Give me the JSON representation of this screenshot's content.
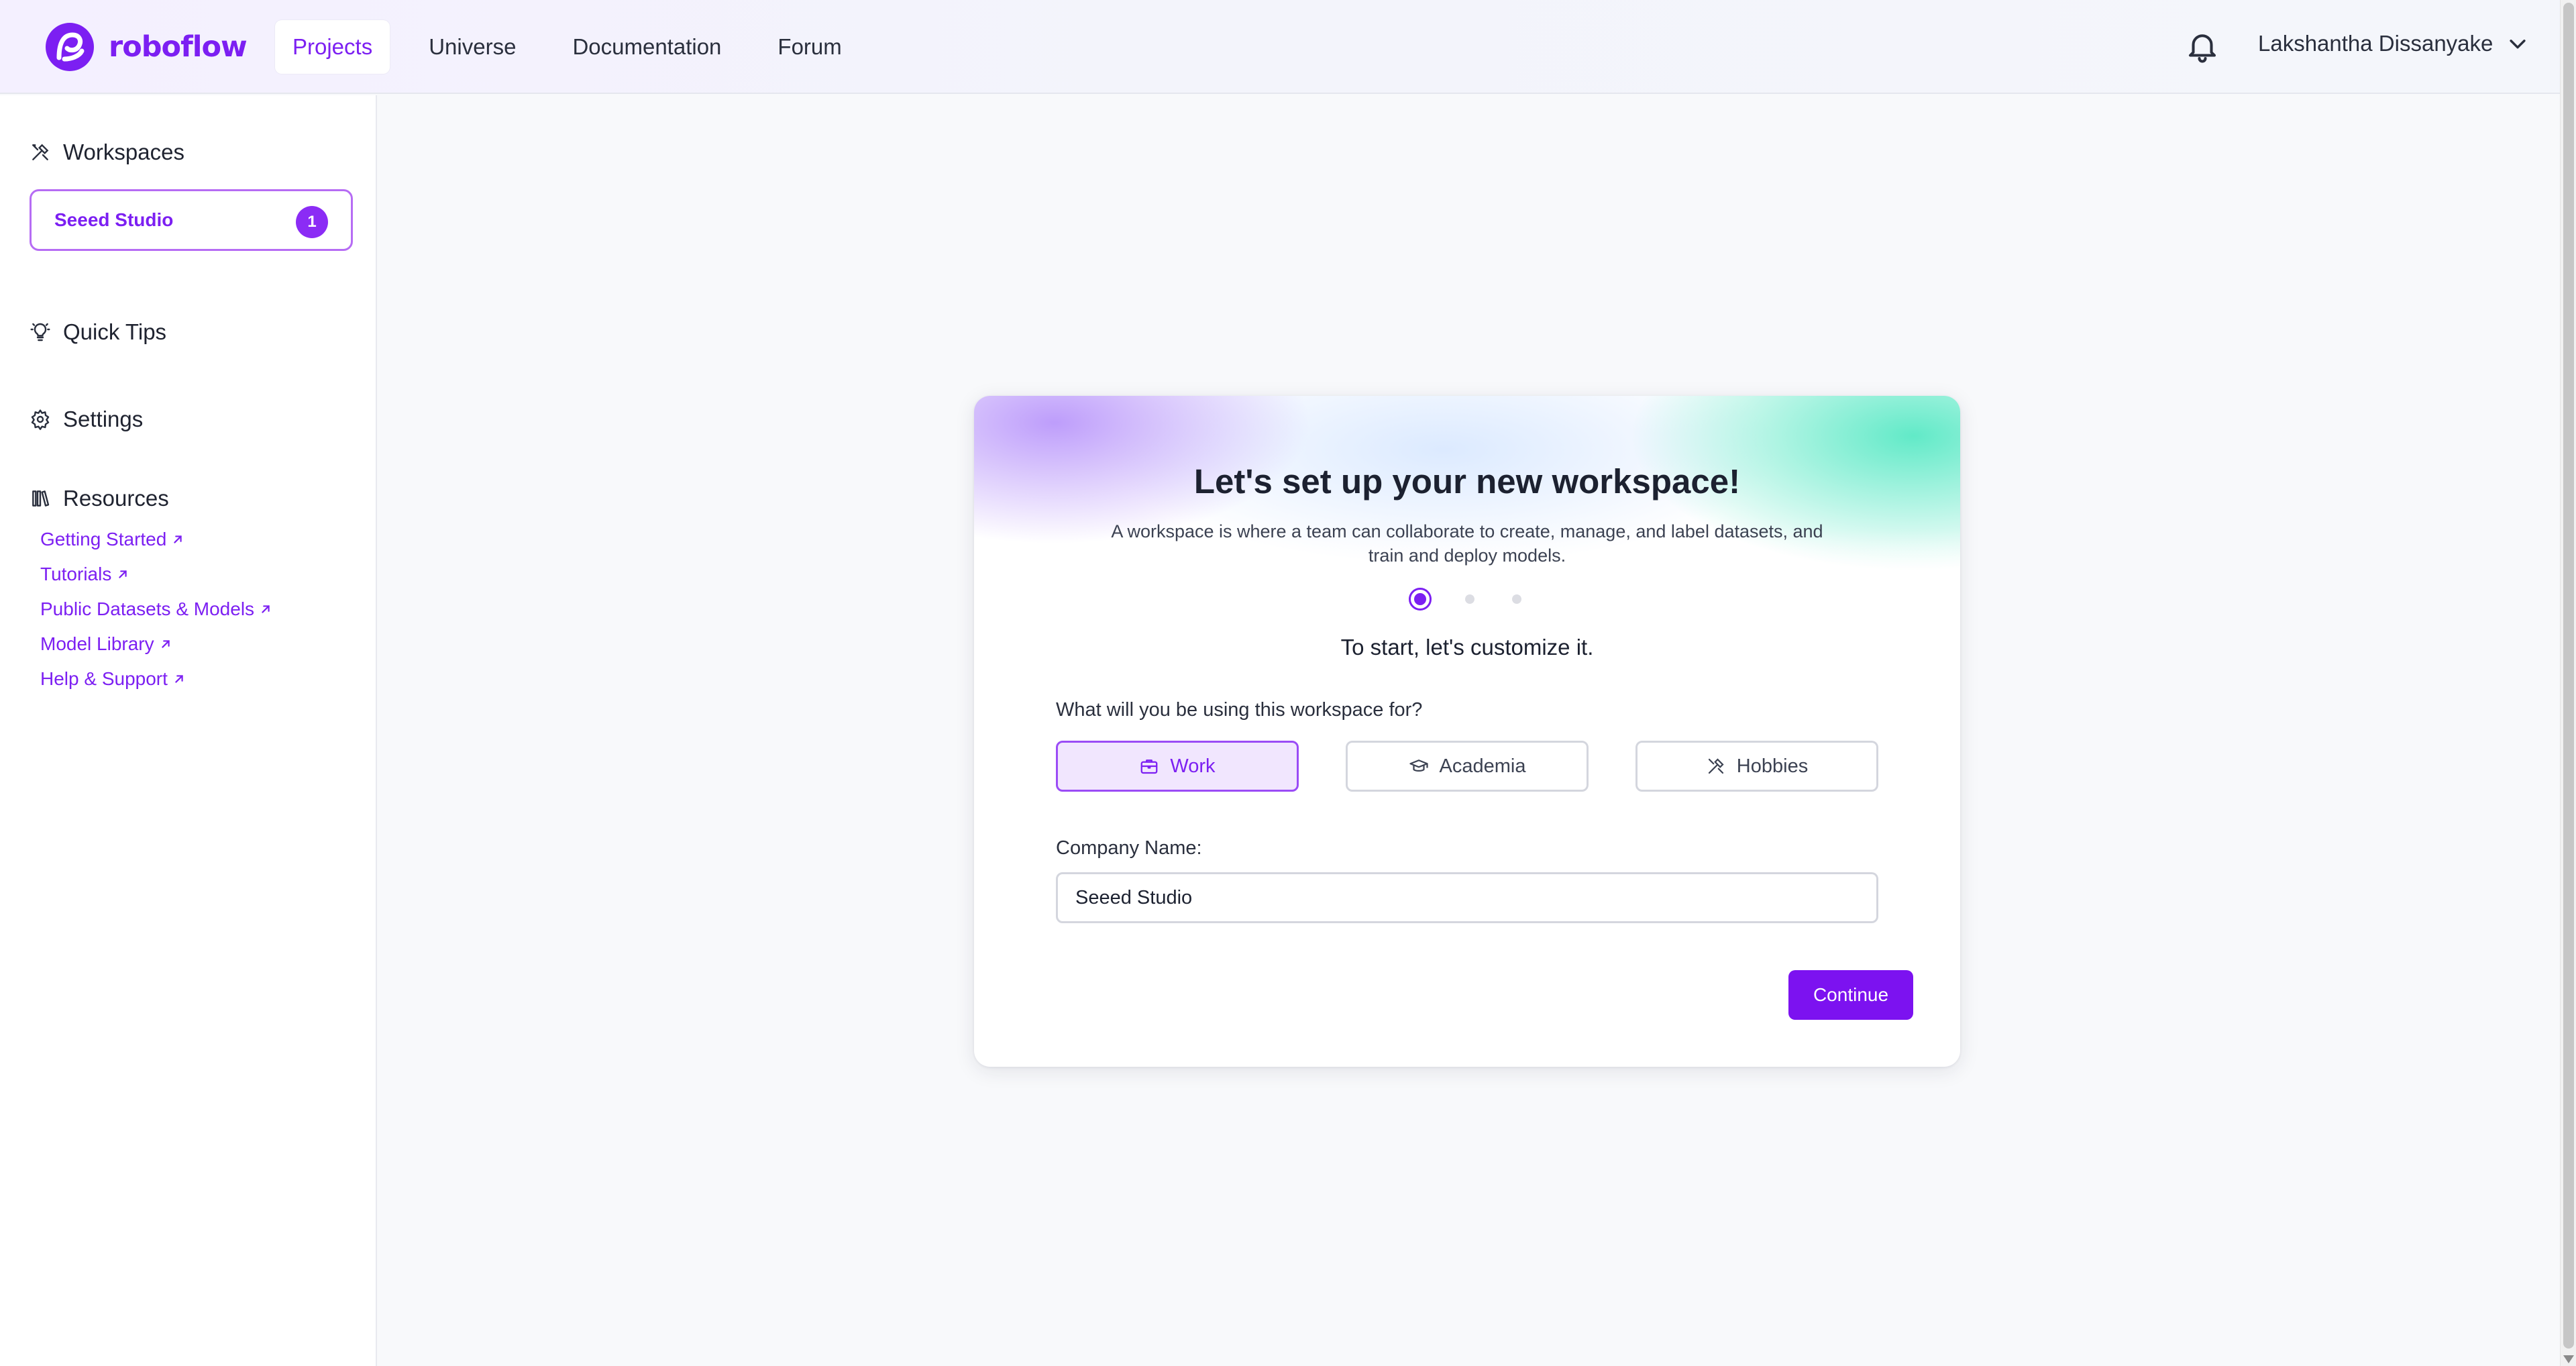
{
  "brand": {
    "name": "roboflow",
    "accent": "#7c1ff2"
  },
  "nav": {
    "items": [
      {
        "label": "Projects",
        "active": true
      },
      {
        "label": "Universe"
      },
      {
        "label": "Documentation"
      },
      {
        "label": "Forum"
      }
    ]
  },
  "header": {
    "notification_icon": "bell-icon",
    "user_name": "Lakshantha Dissanyake",
    "user_menu_icon": "chevron-down-icon"
  },
  "sidebar": {
    "workspaces": {
      "title": "Workspaces",
      "icon": "workspace-icon",
      "items": [
        {
          "name": "Seeed Studio",
          "badge": "1"
        }
      ]
    },
    "quick_tips": {
      "title": "Quick Tips",
      "icon": "lightbulb-icon"
    },
    "settings": {
      "title": "Settings",
      "icon": "gear-icon"
    },
    "resources": {
      "title": "Resources",
      "icon": "library-icon",
      "links": [
        "Getting Started",
        "Tutorials",
        "Public Datasets & Models",
        "Model Library",
        "Help & Support"
      ]
    }
  },
  "setup": {
    "title": "Let's set up your new workspace!",
    "subtitle": "A workspace is where a team can collaborate to create, manage, and label datasets, and train and deploy models.",
    "steps": {
      "total": 3,
      "current": 1
    },
    "step_heading": "To start, let's customize it.",
    "question": "What will you be using this workspace for?",
    "options": [
      {
        "label": "Work",
        "icon": "briefcase-icon",
        "selected": true
      },
      {
        "label": "Academia",
        "icon": "graduation-cap-icon",
        "selected": false
      },
      {
        "label": "Hobbies",
        "icon": "tools-icon",
        "selected": false
      }
    ],
    "company_label": "Company Name:",
    "company_value": "Seeed Studio",
    "continue_label": "Continue"
  }
}
